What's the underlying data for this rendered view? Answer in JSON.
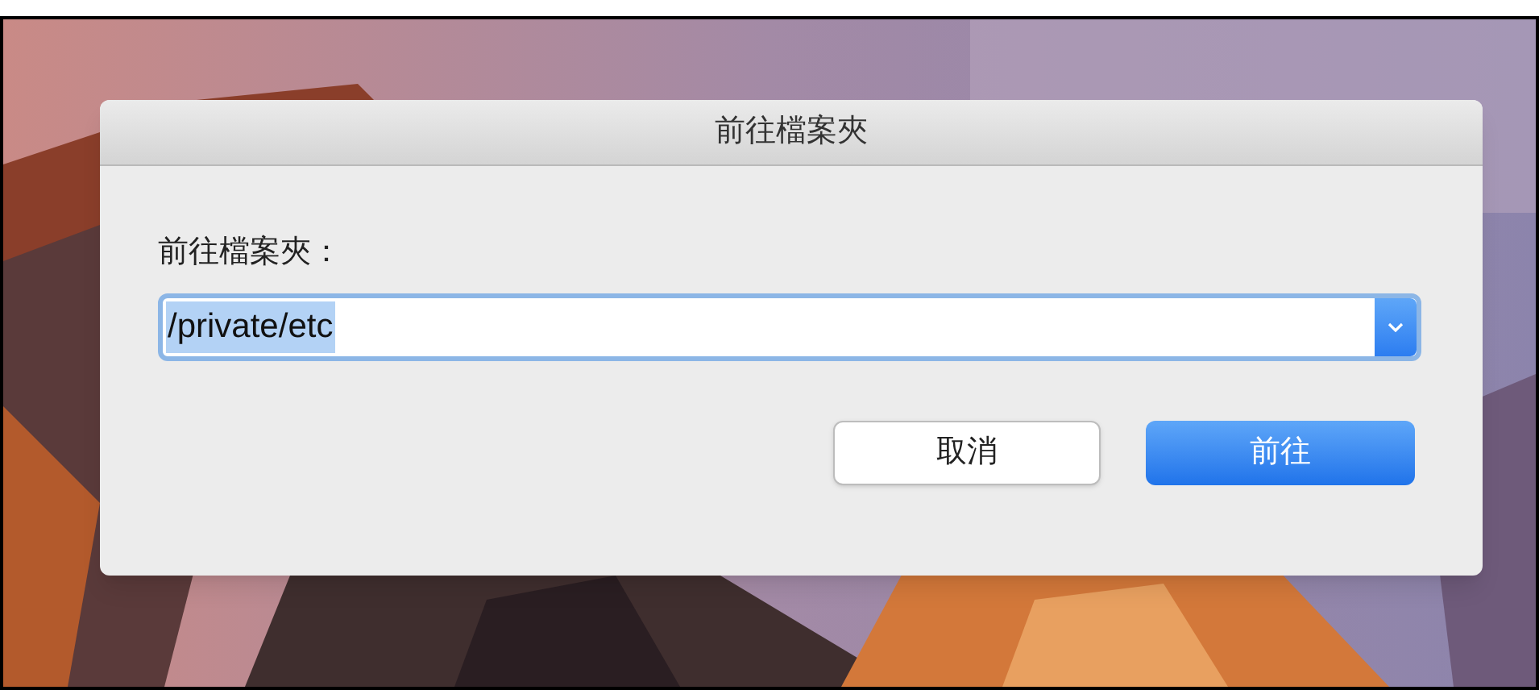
{
  "dialog": {
    "title": "前往檔案夾",
    "label": "前往檔案夾：",
    "path_field": {
      "value": "/private/etc",
      "selected": true
    },
    "buttons": [
      {
        "label": "取消",
        "default": false
      },
      {
        "label": "前往",
        "default": true
      }
    ]
  }
}
